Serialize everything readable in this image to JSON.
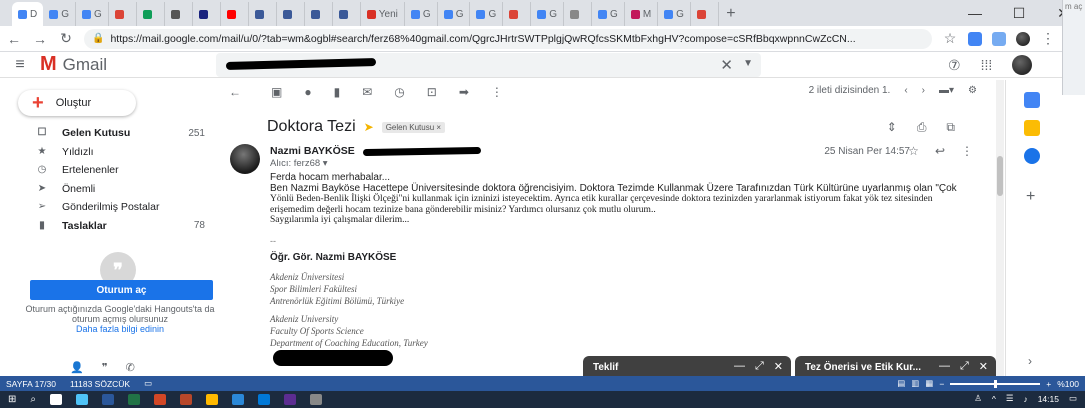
{
  "browser": {
    "tabs": [
      {
        "label": "D",
        "color": "#4285f4"
      },
      {
        "label": "G",
        "color": "#4285f4"
      },
      {
        "label": "G",
        "color": "#4285f4"
      },
      {
        "label": "",
        "color": "#db4437"
      },
      {
        "label": "",
        "color": "#0f9d58"
      },
      {
        "label": "",
        "color": "#555555"
      },
      {
        "label": "",
        "color": "#1a237e"
      },
      {
        "label": "",
        "color": "#ff0000"
      },
      {
        "label": "",
        "color": "#3b5998"
      },
      {
        "label": "",
        "color": "#3b5998"
      },
      {
        "label": "",
        "color": "#3b5998"
      },
      {
        "label": "",
        "color": "#3b5998"
      },
      {
        "label": "Yeni",
        "color": "#d93025"
      },
      {
        "label": "G",
        "color": "#4285f4"
      },
      {
        "label": "G",
        "color": "#4285f4"
      },
      {
        "label": "G",
        "color": "#4285f4"
      },
      {
        "label": "",
        "color": "#db4437"
      },
      {
        "label": "G",
        "color": "#4285f4"
      },
      {
        "label": "",
        "color": "#888888"
      },
      {
        "label": "G",
        "color": "#4285f4"
      },
      {
        "label": "M",
        "color": "#c2185b"
      },
      {
        "label": "G",
        "color": "#4285f4"
      },
      {
        "label": "",
        "color": "#db4437"
      }
    ],
    "url": "https://mail.google.com/mail/u/0/?tab=wm&ogbl#search/ferz68%40gmail.com/QgrcJHrtrSWTPplgjQwRQfcsSKMtbFxhgHV?compose=cSRfBbqxwpnnCwZcCN...",
    "side_peek": "m aç"
  },
  "gmail": {
    "logo_text": "Gmail",
    "compose_label": "Oluştur",
    "nav": [
      {
        "icon": "inbox-icon",
        "glyph": "☐",
        "label": "Gelen Kutusu",
        "count": "251",
        "bold": true
      },
      {
        "icon": "star-icon",
        "glyph": "★",
        "label": "Yıldızlı",
        "count": "",
        "bold": false
      },
      {
        "icon": "clock-icon",
        "glyph": "◷",
        "label": "Ertelenenler",
        "count": "",
        "bold": false
      },
      {
        "icon": "important-icon",
        "glyph": "➤",
        "label": "Önemli",
        "count": "",
        "bold": false
      },
      {
        "icon": "send-icon",
        "glyph": "➢",
        "label": "Gönderilmiş Postalar",
        "count": "",
        "bold": false
      },
      {
        "icon": "draft-icon",
        "glyph": "▮",
        "label": "Taslaklar",
        "count": "78",
        "bold": true
      }
    ],
    "hangouts": {
      "signin_label": "Oturum aç",
      "info_text": "Oturum açtığınızda Google'daki Hangouts'ta da oturum açmış olursunuz",
      "link_text": "Daha fazla bilgi edinin"
    },
    "pager_text": "2 ileti dizisinden 1."
  },
  "email": {
    "subject": "Doktora Tezi",
    "label_chip": "Gelen Kutusu ×",
    "sender_name": "Nazmi BAYKÖSE",
    "recipient": "Alıcı: ferz68 ▾",
    "date": "25 Nisan Per 14:57",
    "greeting": "Ferda hocam merhabalar...",
    "body_line1": "Ben Nazmi Bayköse Hacettepe Üniversitesinde doktora öğrencisiyim. Doktora Tezimde Kullanmak Üzere Tarafınızdan Türk Kültürüne uyarlanmış olan \"Çok",
    "body_line2": "Yönlü Beden-Benlik İlişki Ölçeği\"ni kullanmak için izninizi isteyecektim. Ayrıca etik kurallar çerçevesinde doktora tezinizden yararlanmak istiyorum fakat yök tez sitesinden",
    "body_line3": "erişemedim değerli hocam tezinize bana gönderebilir misiniz? Yardımcı olursanız çok mutlu olurum..",
    "body_line4": "Saygılarımla iyi çalışmalar dilerim...",
    "sig_dash": "--",
    "sig_name": "Öğr. Gör. Nazmi BAYKÖSE",
    "sig_tr1": "Akdeniz Üniversitesi",
    "sig_tr2": "Spor Bilimleri Fakültesi",
    "sig_tr3": "Antrenörlük Eğitimi Bölümü, Türkiye",
    "sig_en1": "Akdeniz University",
    "sig_en2": "Faculty Of Sports Science",
    "sig_en3": "Department of Coaching Education, Turkey"
  },
  "popups": {
    "popup1_title": "Teklif",
    "popup2_title": "Tez Önerisi ve Etik Kur..."
  },
  "wordbar": {
    "page": "SAYFA 17/30",
    "words": "11183 SÖZCÜK",
    "zoom": "%100"
  },
  "taskbar": {
    "time": "14:15",
    "icons": [
      "#ffffff",
      "#4fc3f7",
      "#2b579a",
      "#217346",
      "#d24726",
      "#b7472a",
      "#ffb900",
      "#2b88d8",
      "#0078d7",
      "#5c2d91",
      "#888888"
    ]
  }
}
